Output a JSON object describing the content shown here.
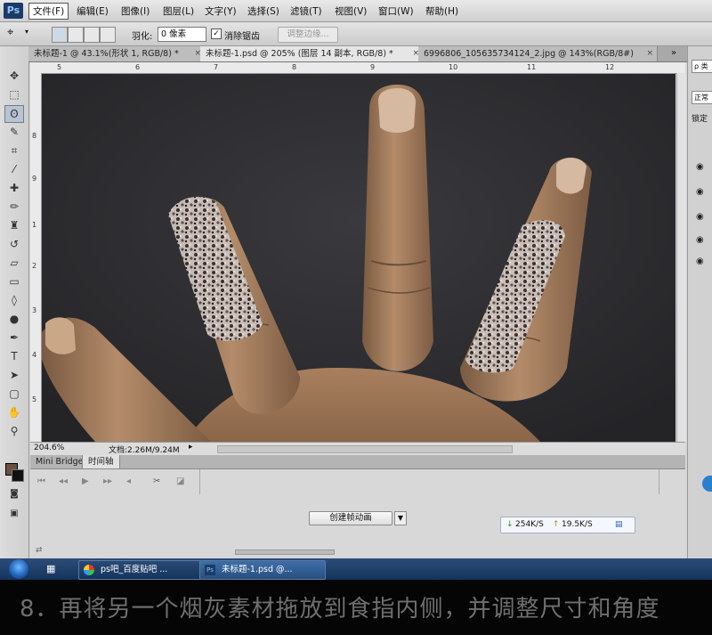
{
  "menubar": {
    "logo": "Ps",
    "items": [
      "文件(F)",
      "编辑(E)",
      "图像(I)",
      "图层(L)",
      "文字(Y)",
      "选择(S)",
      "滤镜(T)",
      "视图(V)",
      "窗口(W)",
      "帮助(H)"
    ]
  },
  "options": {
    "feather_label": "羽化:",
    "feather_value": "0 像素",
    "antialias_label": "消除锯齿",
    "refine_edge_label": "调整边缘..."
  },
  "tabs": [
    {
      "label": "未标题-1 @ 43.1%(形状 1, RGB/8) *",
      "close": "×"
    },
    {
      "label": "未标题-1.psd @ 205% (图层 14 副本, RGB/8) *",
      "close": "×"
    },
    {
      "label": "6996806_105635734124_2.jpg @ 143%(RGB/8#)",
      "close": "×"
    }
  ],
  "rulers": {
    "top": [
      "5",
      "6",
      "7",
      "8",
      "9",
      "10",
      "11",
      "12"
    ],
    "left": [
      "8",
      "9",
      "1",
      "2",
      "3",
      "4",
      "5"
    ]
  },
  "status": {
    "zoom": "204.6%",
    "doc": "文档:2.26M/9.24M"
  },
  "panel": {
    "tabs": [
      "Mini Bridge",
      "时间轴"
    ],
    "create_animation": "创建帧动画",
    "net_down": "254K/S",
    "net_up": "19.5K/S"
  },
  "rightpanel": {
    "search": "ρ 类",
    "mode": "正常",
    "lock": "锁定"
  },
  "taskbar": {
    "items": [
      "ps吧_百度贴吧 ...",
      "未标题-1.psd @..."
    ]
  },
  "caption": {
    "text": "8．再将另一个烟灰素材拖放到食指内侧，并调整尺寸和角度"
  }
}
